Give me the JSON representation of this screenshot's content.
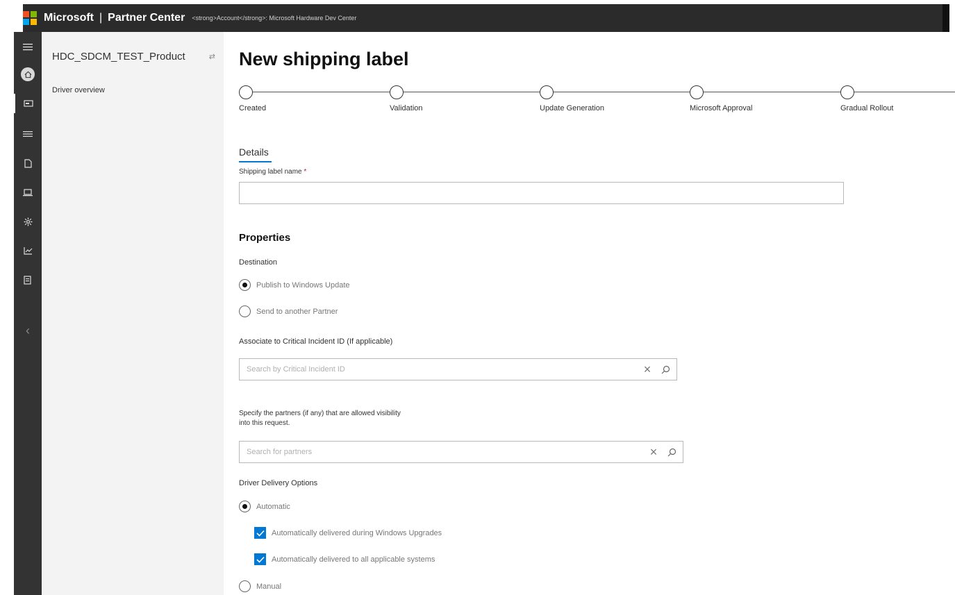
{
  "header": {
    "brand": "Microsoft",
    "product": "Partner Center",
    "breadcrumb": "<strong>Account</strong>: Microsoft Hardware Dev Center",
    "logo_colors": [
      "#f25022",
      "#7fba00",
      "#00a4ef",
      "#ffb900"
    ]
  },
  "left_rail": {
    "icons": [
      "menu-icon",
      "home-icon",
      "driver-icon",
      "list-icon",
      "document-icon",
      "device-icon",
      "settings-icon",
      "chart-icon",
      "report-icon"
    ],
    "collapse_glyph": "‹"
  },
  "side_panel": {
    "product_name": "HDC_SDCM_TEST_Product",
    "nav_item": "Driver overview"
  },
  "main": {
    "title": "New shipping label",
    "steps": [
      {
        "label": "Created"
      },
      {
        "label": "Validation"
      },
      {
        "label": "Update Generation"
      },
      {
        "label": "Microsoft Approval"
      },
      {
        "label": "Gradual Rollout"
      }
    ],
    "details_tab": "Details",
    "shipping_label_name": {
      "label": "Shipping label name",
      "required_mark": "*",
      "value": ""
    },
    "properties_title": "Properties",
    "destination": {
      "label": "Destination",
      "options": [
        {
          "label": "Publish to Windows Update",
          "selected": true
        },
        {
          "label": "Send to another Partner",
          "selected": false
        }
      ]
    },
    "critical_incident": {
      "label": "Associate to Critical Incident ID (If applicable)",
      "placeholder": "Search by Critical Incident ID",
      "value": ""
    },
    "partners": {
      "label_line1": "Specify the partners (if any) that are allowed visibility",
      "label_line2": "into this request.",
      "placeholder": "Search for partners",
      "value": ""
    },
    "delivery": {
      "label": "Driver Delivery Options",
      "automatic_label": "Automatic",
      "automatic_selected": true,
      "checkboxes": [
        {
          "label": "Automatically delivered during Windows Upgrades",
          "checked": true
        },
        {
          "label": "Automatically delivered to all applicable systems",
          "checked": true
        }
      ],
      "manual_label": "Manual",
      "manual_selected": false
    },
    "accent_color": "#0078d4"
  }
}
